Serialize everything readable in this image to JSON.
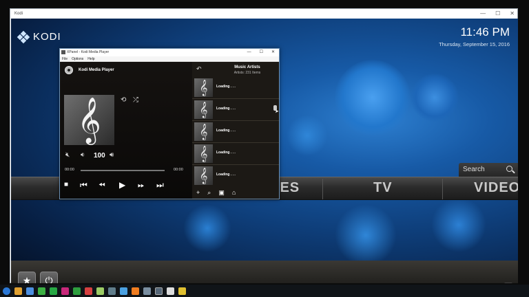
{
  "window": {
    "title": "Kodi",
    "controls": [
      "—",
      "☐",
      "✕"
    ]
  },
  "home": {
    "logo_text": "KODI",
    "time": "11:46 PM",
    "date": "Thursday, September 15, 2016",
    "search_label": "Search",
    "menu": [
      "RES",
      "TV",
      "VIDEO"
    ],
    "buttons": {
      "favourites": "★",
      "power": "⏻",
      "rss": "⌇"
    }
  },
  "xpanel": {
    "title": "XPanel - Kodi Media Player",
    "menu": [
      "File",
      "Options",
      "Help"
    ],
    "player": {
      "name": "Kodi Media Player",
      "volume": "100",
      "elapsed": "00:00",
      "duration": "00:00",
      "clef": "𝄞"
    },
    "list": {
      "title": "Music Artists",
      "subtitle": "Artists: 231 Items",
      "items": [
        "Loading . . .",
        "Loading . . .",
        "Loading . . .",
        "Loading . . .",
        "Loading . . ."
      ]
    },
    "tools": [
      "+",
      "⌕",
      "▣",
      "⌂"
    ]
  },
  "colors": {
    "accent": "#1e6cc2",
    "panel": "#0c0a08"
  }
}
